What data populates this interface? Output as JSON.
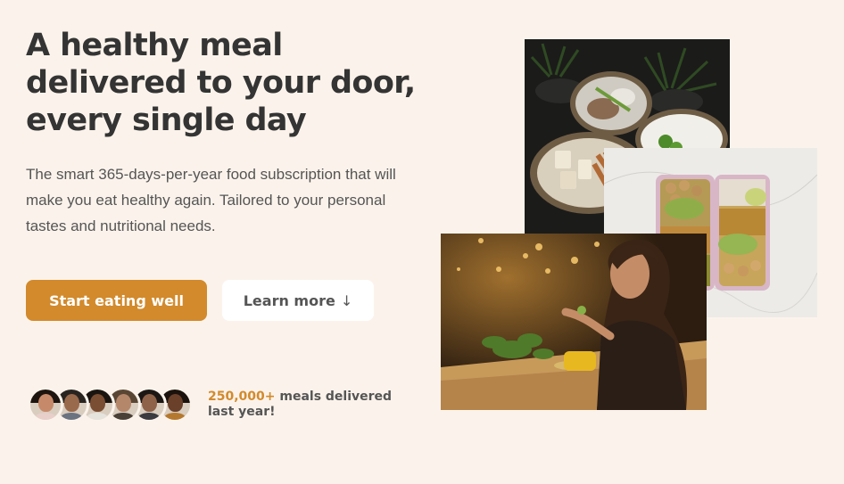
{
  "hero": {
    "headline": "A healthy meal delivered to your door, every single day",
    "description": "The smart 365-days-per-year food subscription that will make you eat healthy again. Tailored to your personal tastes and nutritional needs."
  },
  "ctas": {
    "primary_label": "Start eating well",
    "secondary_label": "Learn more",
    "secondary_arrow": "↓"
  },
  "social_proof": {
    "count": "250,000+",
    "text": " meals delivered last year!",
    "avatars": [
      {
        "name": "customer-1",
        "skin": "#c68a6a",
        "hair": "#1e140f",
        "shirt": "#e8cfc9"
      },
      {
        "name": "customer-2",
        "skin": "#9a6a4c",
        "hair": "#2a2420",
        "shirt": "#6b7381"
      },
      {
        "name": "customer-3",
        "skin": "#7a4e33",
        "hair": "#1a1410",
        "shirt": "#e6e2dc"
      },
      {
        "name": "customer-4",
        "skin": "#b5876a",
        "hair": "#5a4634",
        "shirt": "#4b4038"
      },
      {
        "name": "customer-5",
        "skin": "#8e6249",
        "hair": "#1c1714",
        "shirt": "#3a3a40"
      },
      {
        "name": "customer-6",
        "skin": "#6a402a",
        "hair": "#1b120d",
        "shirt": "#b5782f"
      }
    ]
  },
  "colors": {
    "background": "#fbf3eb",
    "accent": "#d28a2c",
    "heading": "#343434"
  }
}
